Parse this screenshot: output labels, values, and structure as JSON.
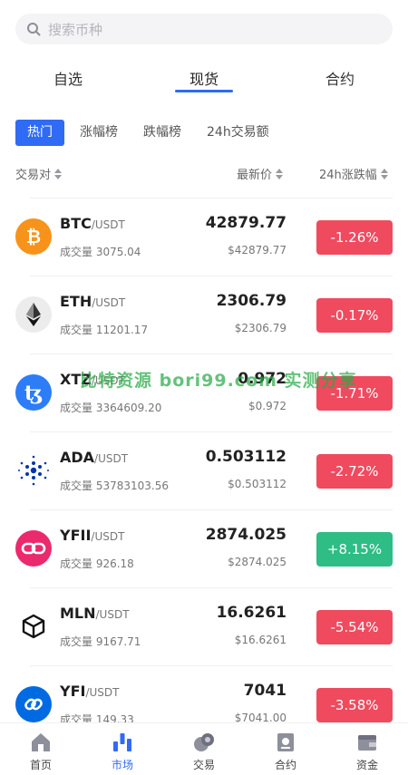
{
  "search": {
    "placeholder": "搜索币种"
  },
  "main_tabs": [
    {
      "label": "自选"
    },
    {
      "label": "现货"
    },
    {
      "label": "合约"
    }
  ],
  "filters": [
    {
      "label": "热门"
    },
    {
      "label": "涨幅榜"
    },
    {
      "label": "跌幅榜"
    },
    {
      "label": "24h交易额"
    }
  ],
  "columns": {
    "pair": "交易对",
    "price": "最新价",
    "change": "24h涨跌幅"
  },
  "rows": [
    {
      "base": "BTC",
      "quote": "/USDT",
      "volume": "成交量 3075.04",
      "price": "42879.77",
      "usd": "$42879.77",
      "change": "-1.26%",
      "icon": "bitcoin-icon"
    },
    {
      "base": "ETH",
      "quote": "/USDT",
      "volume": "成交量 11201.17",
      "price": "2306.79",
      "usd": "$2306.79",
      "change": "-0.17%",
      "icon": "ethereum-icon"
    },
    {
      "base": "XTZ",
      "quote": "/USDT",
      "volume": "成交量 3364609.20",
      "price": "0.972",
      "usd": "$0.972",
      "change": "-1.71%",
      "icon": "tezos-icon"
    },
    {
      "base": "ADA",
      "quote": "/USDT",
      "volume": "成交量 53783103.56",
      "price": "0.503112",
      "usd": "$0.503112",
      "change": "-2.72%",
      "icon": "cardano-icon"
    },
    {
      "base": "YFII",
      "quote": "/USDT",
      "volume": "成交量 926.18",
      "price": "2874.025",
      "usd": "$2874.025",
      "change": "+8.15%",
      "icon": "yfii-icon"
    },
    {
      "base": "MLN",
      "quote": "/USDT",
      "volume": "成交量 9167.71",
      "price": "16.6261",
      "usd": "$16.6261",
      "change": "-5.54%",
      "icon": "melon-icon"
    },
    {
      "base": "YFI",
      "quote": "/USDT",
      "volume": "成交量 149.33",
      "price": "7041",
      "usd": "$7041.00",
      "change": "-3.58%",
      "icon": "yearn-icon"
    }
  ],
  "watermark": "比特资源 bori99.com 实测分享",
  "bottom_nav": [
    {
      "label": "首页",
      "icon": "home-icon"
    },
    {
      "label": "市场",
      "icon": "market-icon"
    },
    {
      "label": "交易",
      "icon": "trade-icon"
    },
    {
      "label": "合约",
      "icon": "contract-icon"
    },
    {
      "label": "资金",
      "icon": "wallet-icon"
    }
  ],
  "colors": {
    "accent": "#2f6bf5",
    "down": "#f04a5f",
    "up": "#2dbd85"
  }
}
